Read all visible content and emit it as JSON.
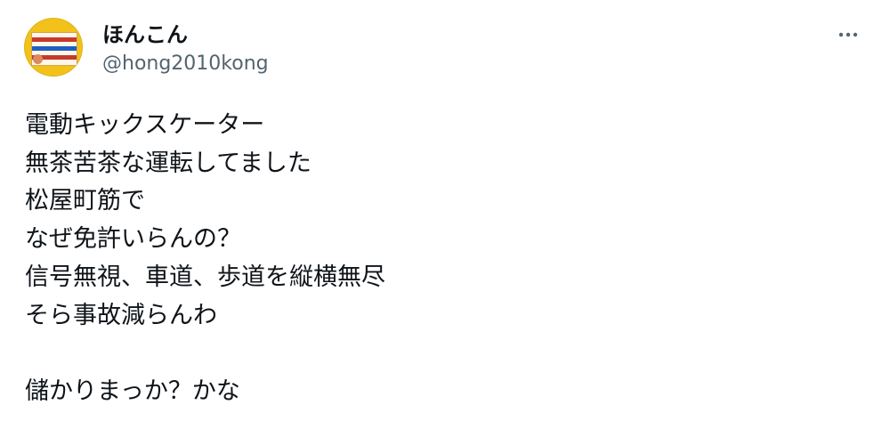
{
  "author": {
    "display_name": "ほんこん",
    "handle": "@hong2010kong",
    "avatar_icon": "profile-avatar"
  },
  "actions": {
    "more_icon": "more-horizontal-icon"
  },
  "tweet": {
    "lines": [
      "電動キックスケーター",
      "無茶苦茶な運転してました",
      "松屋町筋で",
      "なぜ免許いらんの？",
      "信号無視、車道、歩道を縦横無尽",
      "そら事故減らんわ",
      "",
      "儲かりまっか？かな"
    ]
  },
  "colors": {
    "text_primary": "#0f1419",
    "text_secondary": "#536471",
    "background": "#ffffff"
  }
}
